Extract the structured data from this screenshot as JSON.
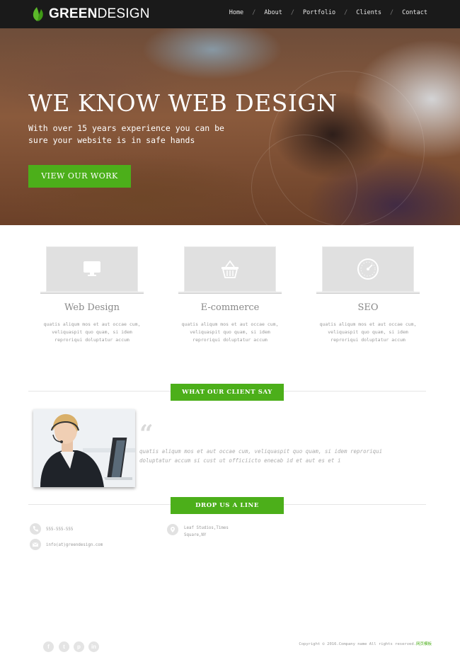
{
  "header": {
    "logo_bold": "GREEN",
    "logo_light": "DESIGN",
    "nav": [
      {
        "label": "Home"
      },
      {
        "label": "About"
      },
      {
        "label": "Portfolio"
      },
      {
        "label": "Clients"
      },
      {
        "label": "Contact"
      }
    ],
    "separator": "/"
  },
  "hero": {
    "title": "WE KNOW WEB DESIGN",
    "subtitle_line1": "With over 15 years experience you can be",
    "subtitle_line2": "sure your website is in safe hands",
    "button_label": "VIEW OUR WORK"
  },
  "services": [
    {
      "title": "Web Design",
      "icon": "monitor-icon",
      "text_line1": "quatis aliqum mos et aut occae cum,",
      "text_line2": "veliquaspit quo quam, si idem",
      "text_line3": "reproriqui doluptatur accum"
    },
    {
      "title": "E-commerce",
      "icon": "basket-icon",
      "text_line1": "quatis aliqum mos et aut occae cum,",
      "text_line2": "veliquaspit quo quam, si idem",
      "text_line3": "reproriqui doluptatur accum"
    },
    {
      "title": "SEO",
      "icon": "speedometer-icon",
      "text_line1": "quatis aliqum mos et aut occae cum,",
      "text_line2": "veliquaspit quo quam, si idem",
      "text_line3": "reproriqui doluptatur accum"
    }
  ],
  "testimonial": {
    "section_label": "WHAT OUR CLIENT SAY",
    "quote_mark": "“",
    "quote_line1": "quatis aliqum mos et aut occae cum, veliquaspit quo quam, si idem reproriqui",
    "quote_line2": "doluptatur accum si cust ut officiicto enecab id et aut es et i"
  },
  "contact": {
    "section_label": "DROP US A LINE",
    "phone": "555-555-555",
    "email": "info(at)greendesign.com",
    "address_line1": "Leaf Studios,Times",
    "address_line2": "Square,NY"
  },
  "footer": {
    "social": [
      {
        "label": "f",
        "icon": "facebook-icon"
      },
      {
        "label": "t",
        "icon": "twitter-icon"
      },
      {
        "label": "p",
        "icon": "pinterest-icon"
      },
      {
        "label": "in",
        "icon": "linkedin-icon"
      }
    ],
    "copyright": "Copyright © 2016.Company name All rights reserved.",
    "copyright_brand": "网页模板"
  },
  "colors": {
    "accent": "#4caf1a",
    "nav_bg": "#1a1a1a"
  }
}
